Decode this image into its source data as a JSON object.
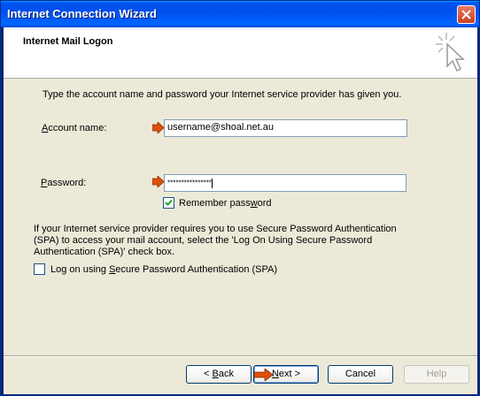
{
  "window": {
    "title": "Internet Connection Wizard",
    "close_label": "×"
  },
  "header": {
    "title": "Internet Mail Logon"
  },
  "content": {
    "instruction": "Type the account name and password your Internet service provider has given you.",
    "account_label_first": "A",
    "account_label_rest": "ccount name:",
    "account_value": "username@shoal.net.au",
    "password_label_first": "P",
    "password_label_rest": "assword:",
    "password_value": "****************",
    "remember_label_before": "Remember pass",
    "remember_label_accel": "w",
    "remember_label_after": "ord",
    "remember_checked": true,
    "spa_info_line1": "If your Internet service provider requires you to use Secure Password Authentication",
    "spa_info_line2": "(SPA) to access your mail account, select the 'Log On Using Secure Password",
    "spa_info_line3": "Authentication (SPA)' check box.",
    "spa_label_before": "Log on using ",
    "spa_label_accel": "S",
    "spa_label_after": "ecure Password Authentication (SPA)",
    "spa_checked": false
  },
  "buttons": {
    "back_prefix": "< ",
    "back_accel": "B",
    "back_rest": "ack",
    "next_accel": "N",
    "next_rest": "ext >",
    "cancel": "Cancel",
    "help": "Help"
  },
  "colors": {
    "marker": "#e0500a"
  }
}
